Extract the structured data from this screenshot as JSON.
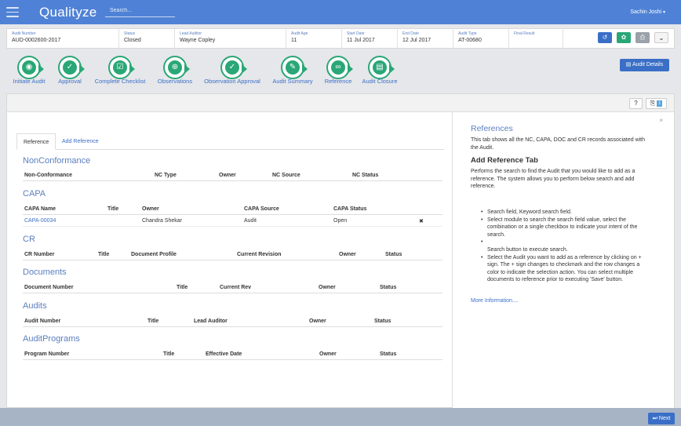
{
  "header": {
    "logo": "Qualityze",
    "search_placeholder": "Search...",
    "user": "Sachin Joshi",
    "user_caret": "▾",
    "menu_icon": "hamburger-icon"
  },
  "info": {
    "fields": [
      {
        "label": "Audit Number",
        "value": "AUD-0002600-2017"
      },
      {
        "label": "Status",
        "value": "Closed"
      },
      {
        "label": "Lead Auditor",
        "value": "Wayne Copley"
      },
      {
        "label": "Audit Age",
        "value": "11"
      },
      {
        "label": "Start Date",
        "value": "11 Jul 2017"
      },
      {
        "label": "End Date",
        "value": "12 Jul 2017"
      },
      {
        "label": "Audit Type",
        "value": "AT-00680"
      },
      {
        "label": "Final Result",
        "value": ""
      }
    ],
    "actions": [
      {
        "icon": "history-icon",
        "glyph": "↺",
        "color": "#3b6fc7"
      },
      {
        "icon": "settings-icon",
        "glyph": "✿",
        "color": "#2aa776"
      },
      {
        "icon": "print-icon",
        "glyph": "⎙",
        "color": "#9aa1a8"
      },
      {
        "icon": "chevron-down-icon",
        "glyph": "⌄",
        "color": "#f4f4f4"
      }
    ]
  },
  "workflow": [
    {
      "label": "Initiate Audit",
      "icon": "eye-icon",
      "glyph": "◉"
    },
    {
      "label": "Approval",
      "icon": "thumbs-up-icon",
      "glyph": "✓"
    },
    {
      "label": "Complete Checklist",
      "icon": "checklist-icon",
      "glyph": "☑"
    },
    {
      "label": "Observations",
      "icon": "magnifier-icon",
      "glyph": "⊕"
    },
    {
      "label": "Observation Approval",
      "icon": "thumbs-up-icon",
      "glyph": "✓"
    },
    {
      "label": "Audit Summary",
      "icon": "pencil-icon",
      "glyph": "✎"
    },
    {
      "label": "Reference",
      "icon": "link-icon",
      "glyph": "∞"
    },
    {
      "label": "Audit Closure",
      "icon": "document-icon",
      "glyph": "▤"
    }
  ],
  "audit_details_label": "Audit Details",
  "panel": {
    "help_btn": "?",
    "attach_count": "1",
    "tabs": [
      "Reference",
      "Add Reference"
    ],
    "sections": [
      {
        "title": "NonConformance",
        "columns": [
          "Non-Conformance",
          "NC Type",
          "Owner",
          "NC Source",
          "NC Status"
        ],
        "rows": []
      },
      {
        "title": "CAPA",
        "columns": [
          "CAPA Name",
          "Title",
          "Owner",
          "CAPA Source",
          "CAPA Status"
        ],
        "rows": [
          {
            "name": "CAPA-00034",
            "title": "",
            "owner": "Chandra Shekar",
            "source": "Audit",
            "status": "Open",
            "remove": "✖"
          }
        ]
      },
      {
        "title": "CR",
        "columns": [
          "CR Number",
          "Title",
          "Document Profile",
          "Current Revision",
          "Owner",
          "Status"
        ],
        "rows": []
      },
      {
        "title": "Documents",
        "columns": [
          "Document Number",
          "Title",
          "Current Rev",
          "Owner",
          "Status"
        ],
        "rows": []
      },
      {
        "title": "Audits",
        "columns": [
          "Audit Number",
          "Title",
          "Lead Auditor",
          "Owner",
          "Status"
        ],
        "rows": []
      },
      {
        "title": "AuditPrograms",
        "columns": [
          "Program Number",
          "Title",
          "Effective Date",
          "Owner",
          "Status"
        ],
        "rows": []
      }
    ]
  },
  "help": {
    "close": "×",
    "title": "References",
    "intro": "This tab shows all the NC, CAPA, DOC and CR records associated with the Audit.",
    "subtitle": "Add Reference Tab",
    "body": "Performs the search to find the Audit that you would like to add as a reference. The system allows you to perform below search and add reference.",
    "bullets": [
      "Search field, Keyword search field.",
      "Select module to search the search field value, select the combination or a single checkbox to indicate your intent of the search.",
      "",
      "Search button to execute search.",
      "Select the Audit you want to add as a reference by clicking on + sign. The + sign changes to checkmark and the row changes a color to indicate the selection action. You can select multiple documents to reference prior to executing 'Save' button."
    ],
    "more": "More Information...."
  },
  "next_label": "Next"
}
